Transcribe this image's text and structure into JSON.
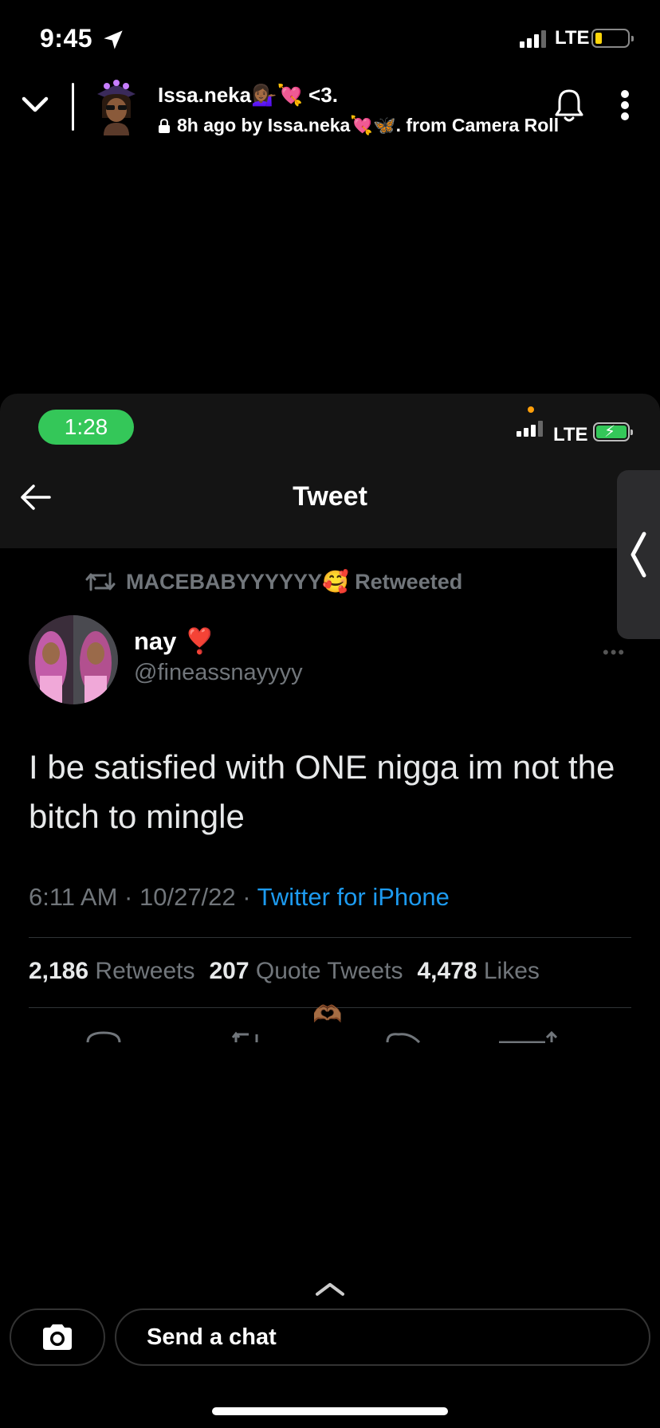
{
  "status_bar": {
    "time": "9:45",
    "network": "LTE"
  },
  "story_header": {
    "title": "Issa.neka💁🏾‍♀️💘 <3.",
    "meta": "8h ago by Issa.neka💘🦋. from Camera Roll",
    "icons": [
      "chevron-down-icon",
      "bitmoji-avatar",
      "lock-icon",
      "bell-icon",
      "more-vertical-icon"
    ]
  },
  "embedded_screenshot": {
    "status_bar": {
      "time": "1:28",
      "network": "LTE"
    },
    "nav_title": "Tweet",
    "retweeted_by": "MACEBABYYYYYY🥰 Retweeted",
    "author": {
      "display_name": "nay",
      "badge_emoji": "❣️",
      "handle": "@fineassnayyyy"
    },
    "tweet_text": "I be satisfied with ONE nigga im not the bitch to mingle",
    "timestamp": "6:11 AM · 10/27/22 · ",
    "source": "Twitter for iPhone",
    "stats": [
      {
        "count": "2,186",
        "label": "Retweets"
      },
      {
        "count": "207",
        "label": "Quote Tweets"
      },
      {
        "count": "4,478",
        "label": "Likes"
      }
    ],
    "reaction_emoji": "🫶🏾"
  },
  "bottom_bar": {
    "chat_placeholder": "Send a chat"
  },
  "colors": {
    "twitter_blue": "#1d9bf0",
    "muted_gray": "#71767b",
    "pill_green": "#34c759"
  }
}
